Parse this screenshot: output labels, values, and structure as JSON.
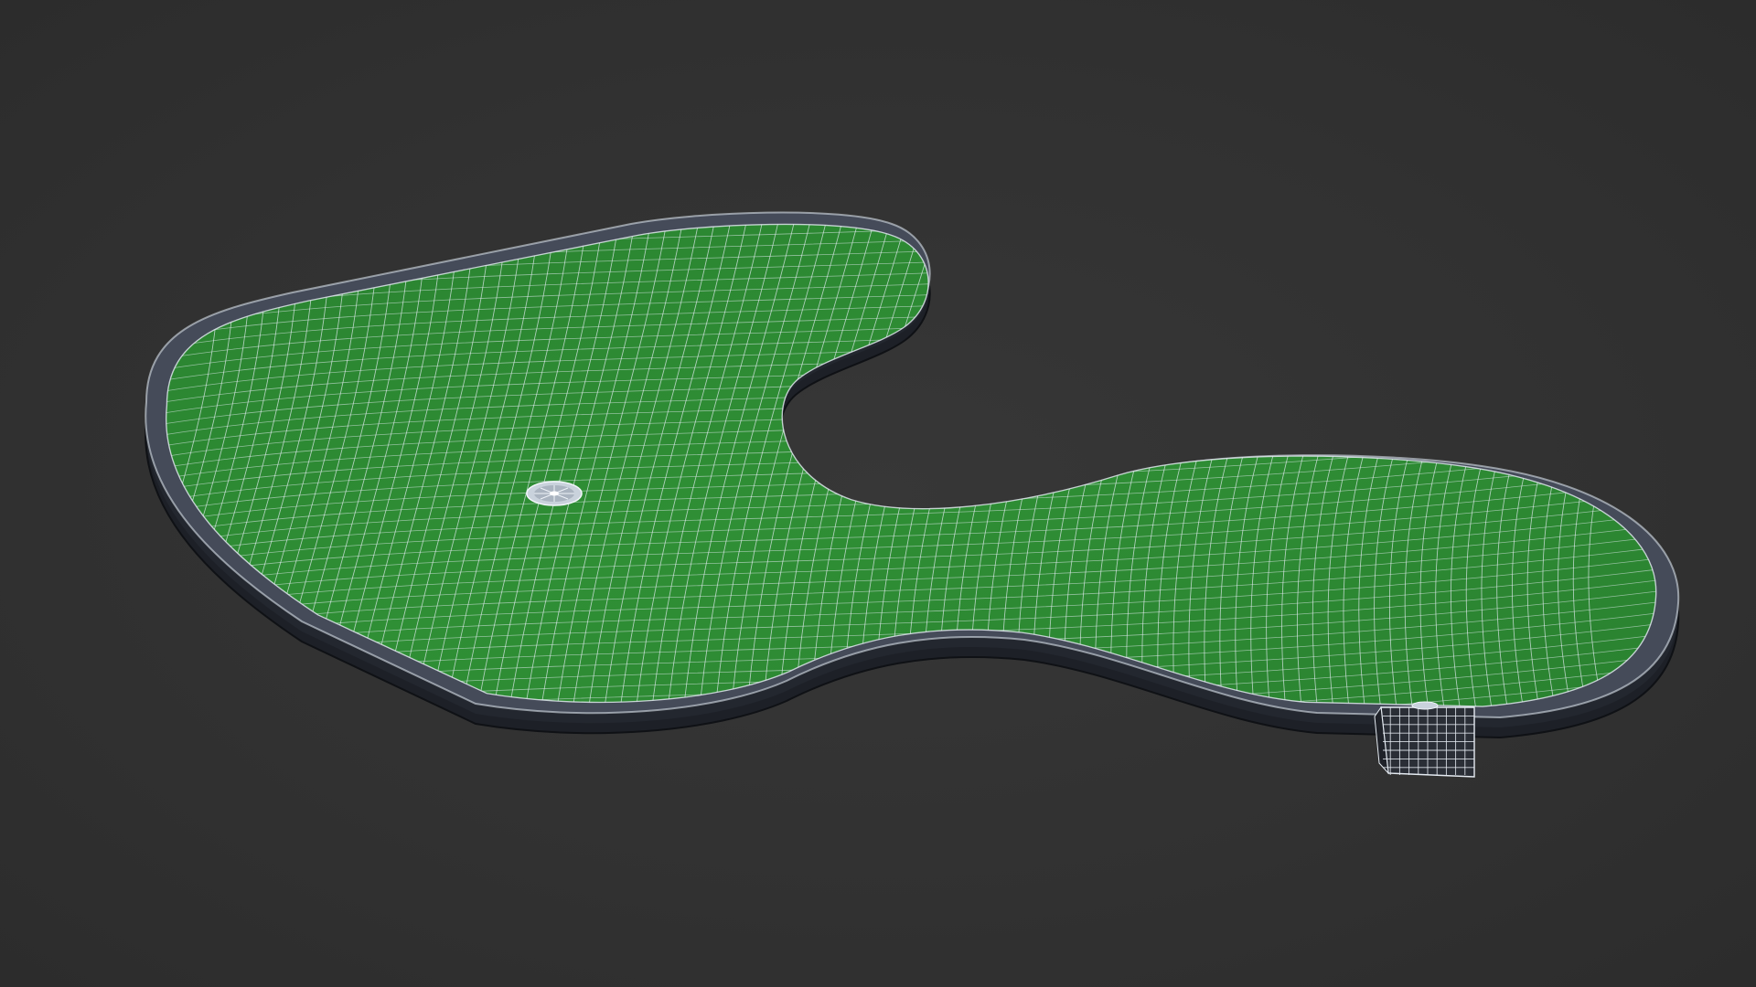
{
  "scene": {
    "background_color": "#323232",
    "turf_color": "#2d8a32",
    "turf_highlight_color": "#38a33c",
    "border_top_color": "#3c4250",
    "border_side_color": "#22262e",
    "wire_color": "#e8eef6",
    "objects": [
      {
        "name": "putting-green-mesh"
      },
      {
        "name": "golf-cup"
      },
      {
        "name": "corner-box-mesh"
      }
    ]
  }
}
